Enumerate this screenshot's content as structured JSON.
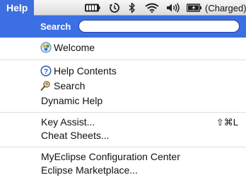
{
  "menubar": {
    "title": "Help",
    "status": {
      "battery_text": "(Charged)",
      "icons": [
        "battery-meter-icon",
        "time-machine-icon",
        "bluetooth-icon",
        "wifi-icon",
        "volume-icon",
        "battery-icon"
      ]
    }
  },
  "menu": {
    "search": {
      "label": "Search",
      "value": ""
    },
    "items": [
      {
        "label": "Welcome",
        "icon": "eclipse-welcome-icon"
      },
      {
        "label": "Help Contents",
        "icon": "help-question-icon"
      },
      {
        "label": "Search",
        "icon": "help-search-icon"
      },
      {
        "label": "Dynamic Help"
      },
      {
        "label": "Key Assist...",
        "shortcut": "⇧⌘L"
      },
      {
        "label": "Cheat Sheets..."
      },
      {
        "label": "MyEclipse Configuration Center"
      },
      {
        "label": "Eclipse Marketplace..."
      }
    ]
  },
  "colors": {
    "highlight": "#3b6fe3",
    "separator": "#dedede"
  }
}
